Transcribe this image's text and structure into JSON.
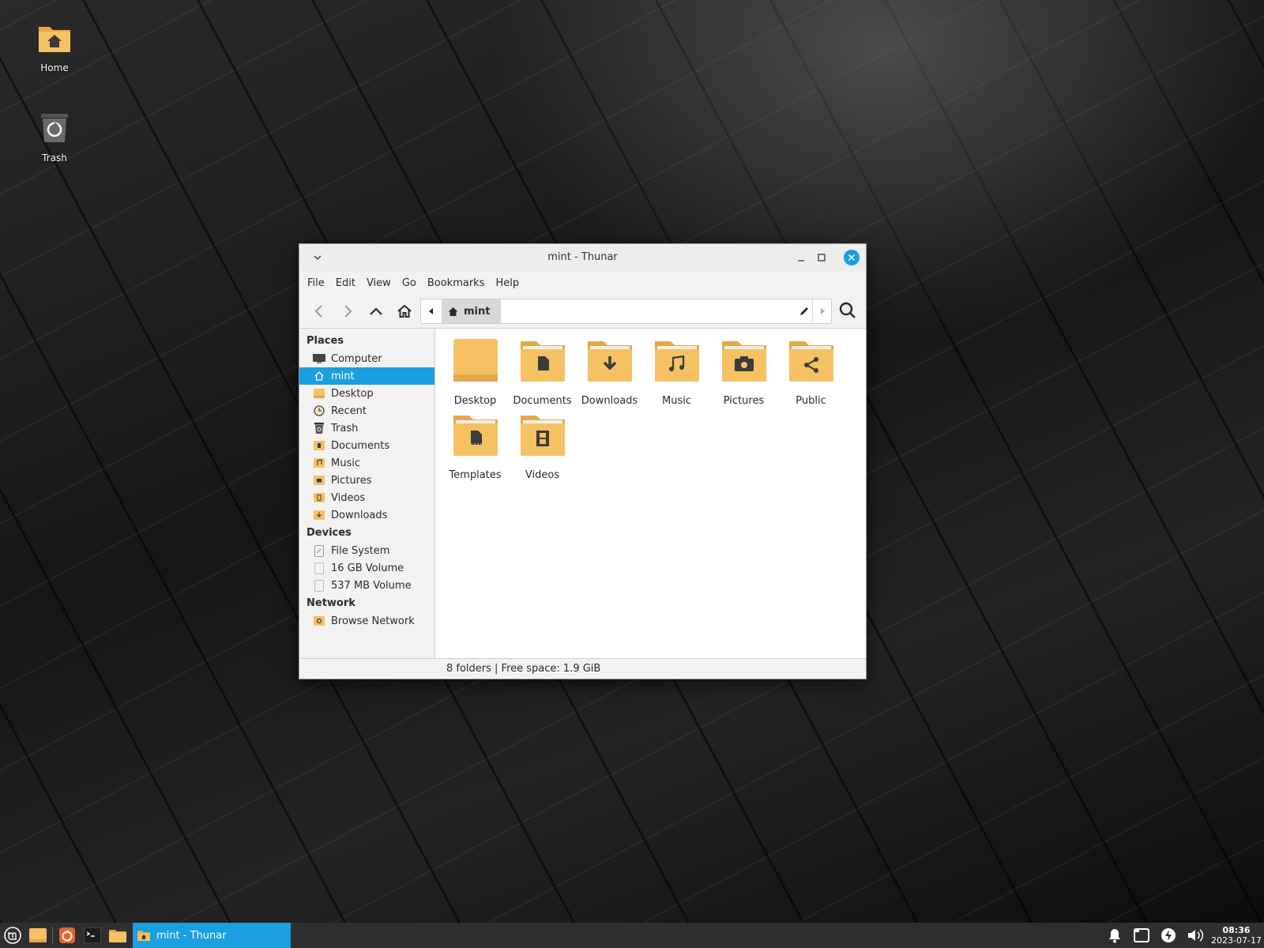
{
  "desktop": {
    "icons": [
      {
        "label": "Home"
      },
      {
        "label": "Trash"
      }
    ]
  },
  "window": {
    "title": "mint - Thunar",
    "menu": [
      "File",
      "Edit",
      "View",
      "Go",
      "Bookmarks",
      "Help"
    ],
    "path": {
      "crumb": "mint"
    },
    "sidebar": {
      "places_title": "Places",
      "places": [
        "Computer",
        "mint",
        "Desktop",
        "Recent",
        "Trash",
        "Documents",
        "Music",
        "Pictures",
        "Videos",
        "Downloads"
      ],
      "devices_title": "Devices",
      "devices": [
        "File System",
        "16 GB Volume",
        "537 MB Volume"
      ],
      "network_title": "Network",
      "network": [
        "Browse Network"
      ],
      "selected": "mint"
    },
    "folders": [
      "Desktop",
      "Documents",
      "Downloads",
      "Music",
      "Pictures",
      "Public",
      "Templates",
      "Videos"
    ],
    "status": "8 folders  |  Free space: 1.9 GiB"
  },
  "taskbar": {
    "task_label": "mint - Thunar",
    "clock_time": "08:36",
    "clock_date": "2023-07-17"
  },
  "colors": {
    "accent": "#1a9fe0",
    "folder": "#f5c163",
    "folder_dark": "#e2a94a",
    "glyph": "#3b3b3b"
  }
}
